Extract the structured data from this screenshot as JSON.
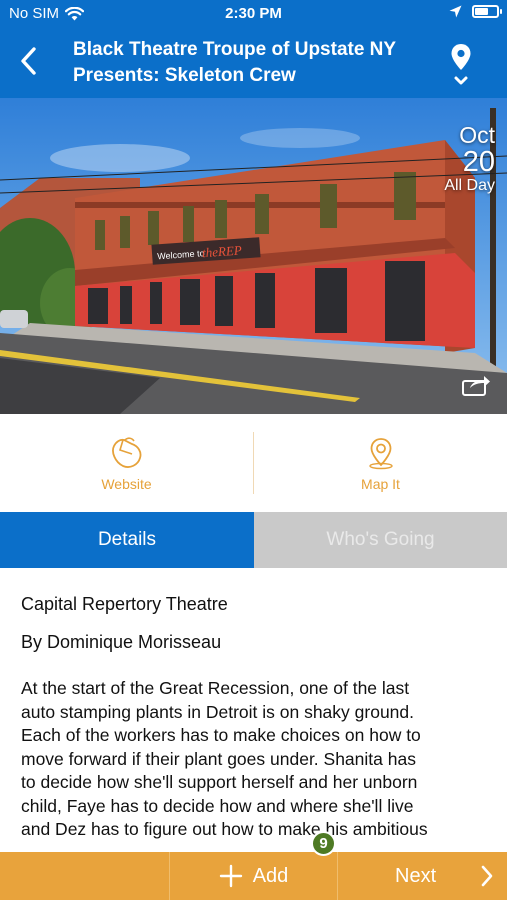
{
  "status_bar": {
    "carrier": "No SIM",
    "time": "2:30 PM"
  },
  "header": {
    "title_line1": "Black Theatre Troupe of Upstate NY",
    "title_line2": "Presents: Skeleton Crew",
    "back_icon": "chevron-left-icon",
    "location_icon": "map-pin-icon"
  },
  "hero": {
    "sign_text": "Welcome to theREP",
    "date": {
      "month": "Oct",
      "day": "20",
      "time": "All Day"
    },
    "share_icon": "share-icon"
  },
  "actions": [
    {
      "label": "Website",
      "icon": "mouse-icon"
    },
    {
      "label": "Map It",
      "icon": "map-pin-icon"
    }
  ],
  "tabs": [
    {
      "label": "Details",
      "active": true
    },
    {
      "label": "Who's Going",
      "active": false
    }
  ],
  "details": {
    "venue": "Capital Repertory Theatre",
    "author": "By Dominique Morisseau",
    "description_lines": [
      "At the start of the Great Recession, one of the last",
      "auto stamping plants in Detroit is on shaky ground.",
      "Each of the workers has to make choices on how to",
      "move forward if their plant goes under. Shanita has",
      "to decide how she'll support herself and her unborn",
      "child, Faye has to decide how and where she'll live",
      "and Dez has to figure out how to make his ambitious"
    ]
  },
  "footer": {
    "add_label": "Add",
    "next_label": "Next",
    "badge_count": "9"
  },
  "colors": {
    "primary_blue": "#0b6fc9",
    "accent_orange": "#e8a33c",
    "inactive_tab": "#c9c9c9",
    "badge_green": "#4e7a24"
  }
}
